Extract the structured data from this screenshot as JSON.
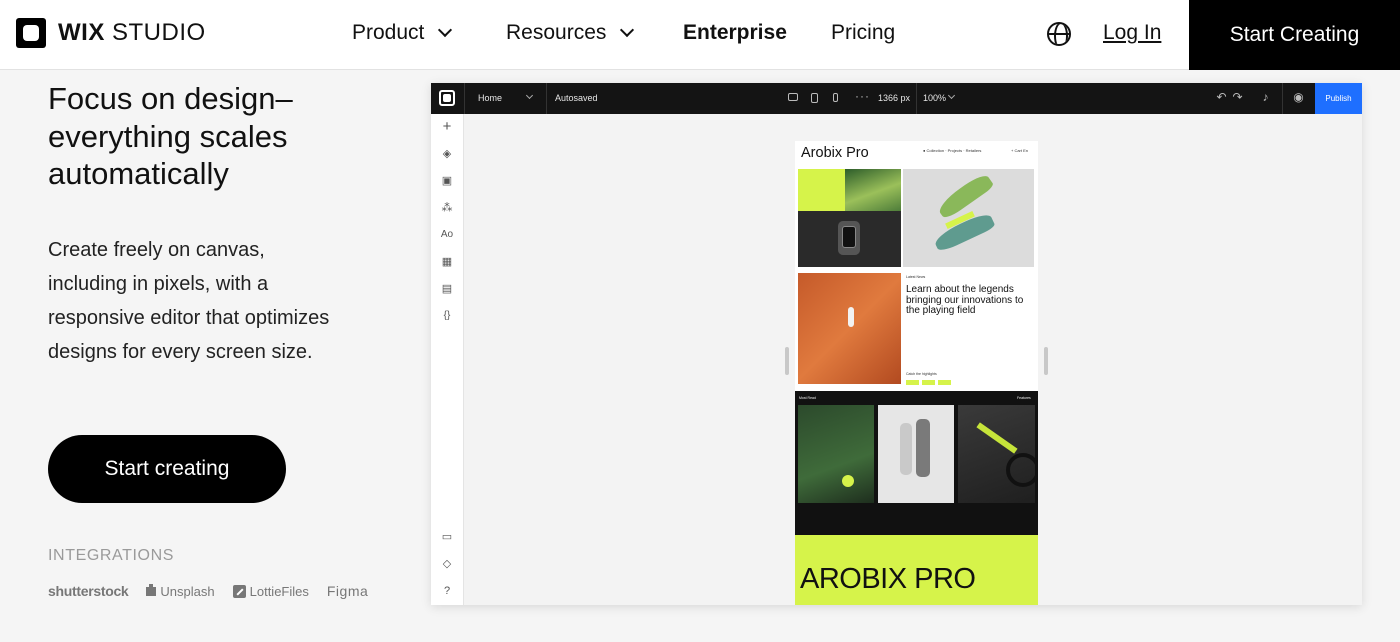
{
  "brand": {
    "name_bold": "WIX",
    "name_light": "STUDIO"
  },
  "nav": {
    "product": "Product",
    "resources": "Resources",
    "enterprise": "Enterprise",
    "pricing": "Pricing",
    "login": "Log In",
    "cta": "Start Creating"
  },
  "hero": {
    "headline": "Focus on design– everything scales automatically",
    "subtext": "Create freely on canvas, including in pixels, with a responsive editor that optimizes designs for every screen size.",
    "cta": "Start creating"
  },
  "integrations": {
    "label": "INTEGRATIONS",
    "partners": [
      "shutterstock",
      "Unsplash",
      "LottieFiles",
      "Figma"
    ]
  },
  "editor": {
    "page": "Home",
    "status": "Autosaved",
    "width": "1366 px",
    "zoom": "100%",
    "publish": "Publish",
    "site": {
      "title": "Arobix Pro",
      "nav": "● Collection · Projects · Retailers",
      "nav_right": "+ Cart  En",
      "news_label": "Latest News",
      "news_title": "Learn about the legends bringing our innovations to the playing field",
      "cta_label": "Catch the highlights",
      "section_left": "Most Read",
      "section_right": "Features",
      "brand_big": "AROBIX PRO"
    }
  },
  "colors": {
    "accent_lime": "#d6f34a",
    "publish_blue": "#1e6fff"
  }
}
